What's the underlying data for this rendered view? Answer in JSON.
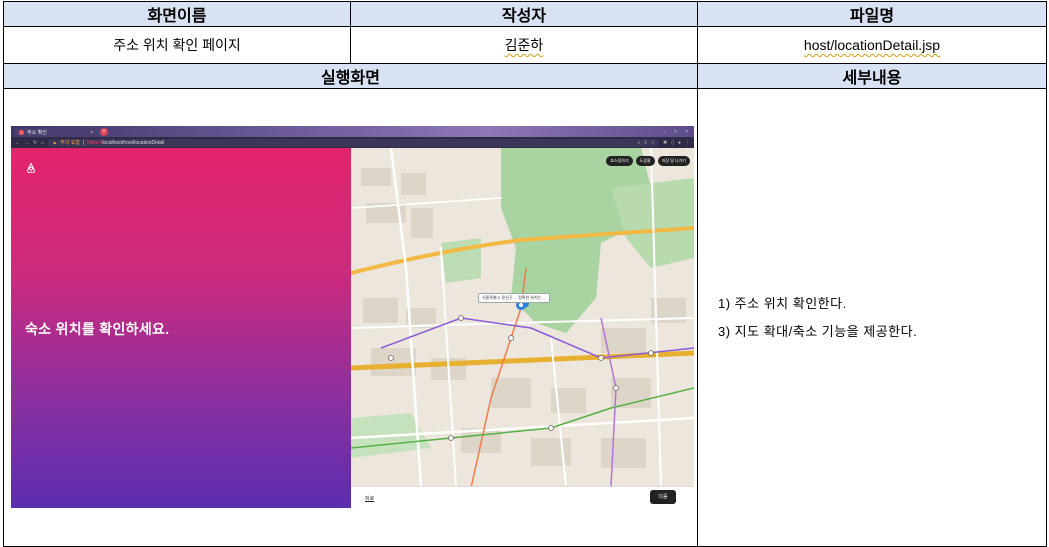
{
  "table": {
    "headers": {
      "screen_name": "화면이름",
      "author": "작성자",
      "file_name": "파일명"
    },
    "values": {
      "screen_name": "주소 위치 확인 페이지",
      "author": "김준하",
      "file_name": "host/locationDetail.jsp"
    },
    "section_headers": {
      "screenshot": "실행화면",
      "details": "세부내용"
    }
  },
  "details": [
    "1) 주소 위치 확인한다.",
    "3) 지도 확대/축소 기능을 제공한다."
  ],
  "browser": {
    "tab_title": "주소 확인",
    "tab_close": "×",
    "new_tab": "+",
    "security_warning": "주의 요함",
    "url_scheme": "https://",
    "url_rest": "localhost/host/locationDetail",
    "window_controls": [
      "–",
      "□",
      "×"
    ]
  },
  "page": {
    "hero_text": "숙소 위치를 확인하세요.",
    "map_buttons": [
      "호스팅하기",
      "도움말",
      "저장 및 나가기"
    ],
    "map_tooltip": "서울특별시 용산구 ... 정확한 위치는 ...",
    "back_link": "뒤로",
    "next_button": "다음"
  },
  "colors": {
    "header_bg": "#d9e2f3",
    "gradient_top": "#e3246b",
    "gradient_bottom": "#5b2eb0",
    "map_park": "#a9d3a0",
    "map_road_major": "#f2b844",
    "map_pin": "#2b7fe0"
  }
}
